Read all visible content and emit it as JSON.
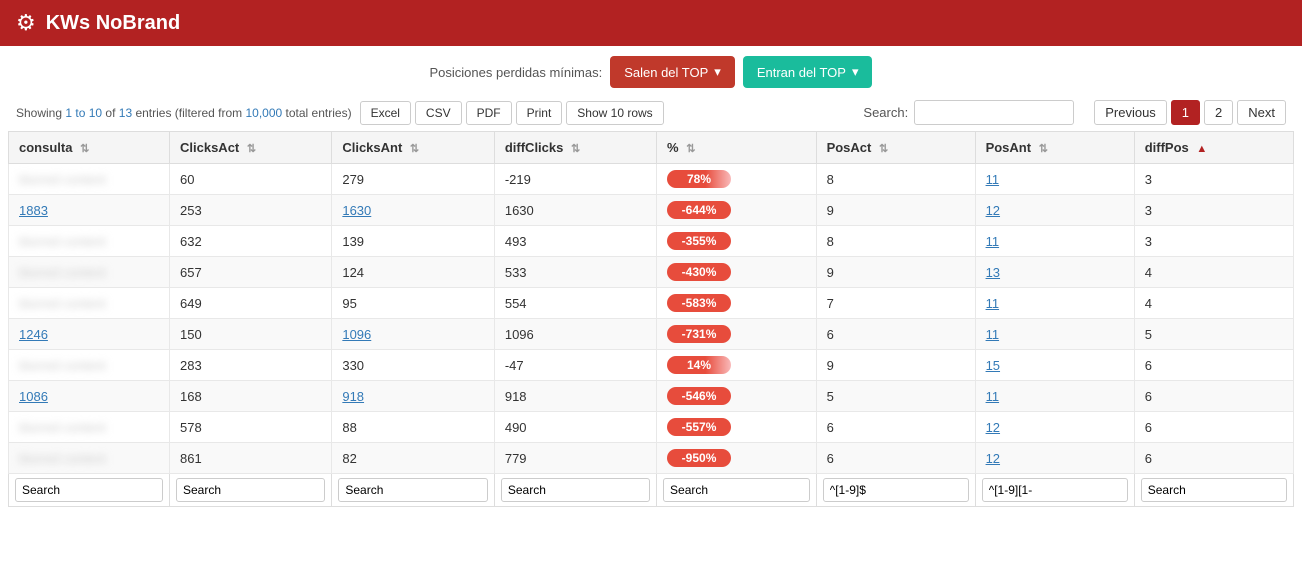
{
  "app": {
    "title": "KWs NoBrand",
    "icon": "⚙"
  },
  "topbar": {
    "label": "Posiciones perdidas mínimas:",
    "btn_salen": "Salen del TOP",
    "btn_entran": "Entran del TOP"
  },
  "subtoolbar": {
    "showing": "Showing ",
    "range": "1 to 10",
    "of": " of ",
    "total": "13",
    "entries": " entries (filtered from ",
    "total_entries": "10,000",
    "total_suffix": " total entries)",
    "excel": "Excel",
    "csv": "CSV",
    "pdf": "PDF",
    "print": "Print",
    "show_rows": "Show 10 rows",
    "search_label": "Search:",
    "prev": "Previous",
    "next": "Next",
    "page1": "1",
    "page2": "2"
  },
  "columns": [
    {
      "key": "consulta",
      "label": "consulta",
      "sort": "both"
    },
    {
      "key": "clicksact",
      "label": "ClicksAct",
      "sort": "both"
    },
    {
      "key": "clicksant",
      "label": "ClicksAnt",
      "sort": "both"
    },
    {
      "key": "diffclicks",
      "label": "diffClicks",
      "sort": "both"
    },
    {
      "key": "pct",
      "label": "%",
      "sort": "both"
    },
    {
      "key": "posact",
      "label": "PosAct",
      "sort": "both"
    },
    {
      "key": "posant",
      "label": "PosAnt",
      "sort": "both"
    },
    {
      "key": "diffpos",
      "label": "diffPos",
      "sort": "asc"
    }
  ],
  "rows": [
    {
      "consulta": "",
      "blurred": true,
      "clicksact": "60",
      "clicksant": "279",
      "diffclicks": "-219",
      "pct": "78%",
      "pct_type": "positive",
      "posact": "8",
      "posant": "11",
      "posant_blue": true,
      "diffpos": "3"
    },
    {
      "consulta": "1883",
      "blurred": false,
      "link": true,
      "clicksact": "253",
      "clicksant": "1630",
      "diffclicks": "1630",
      "pct": "-644%",
      "pct_type": "negative",
      "posact": "9",
      "posant": "12",
      "posant_blue": true,
      "diffpos": "3"
    },
    {
      "consulta": "",
      "blurred": true,
      "clicksact": "632",
      "clicksant": "139",
      "diffclicks": "493",
      "pct": "-355%",
      "pct_type": "negative",
      "posact": "8",
      "posant": "11",
      "posant_blue": true,
      "diffpos": "3"
    },
    {
      "consulta": "",
      "blurred": true,
      "clicksact": "657",
      "clicksant": "124",
      "diffclicks": "533",
      "pct": "-430%",
      "pct_type": "negative",
      "posact": "9",
      "posant": "13",
      "posant_blue": true,
      "diffpos": "4"
    },
    {
      "consulta": "",
      "blurred": true,
      "clicksact": "649",
      "clicksant": "95",
      "diffclicks": "554",
      "pct": "-583%",
      "pct_type": "negative",
      "posact": "7",
      "posant": "11",
      "posant_blue": true,
      "diffpos": "4"
    },
    {
      "consulta": "1246",
      "blurred": false,
      "link": true,
      "clicksact": "150",
      "clicksant": "1096",
      "diffclicks": "1096",
      "pct": "-731%",
      "pct_type": "negative",
      "posact": "6",
      "posant": "11",
      "posant_blue": true,
      "diffpos": "5"
    },
    {
      "consulta": "",
      "blurred": true,
      "clicksact": "283",
      "clicksant": "330",
      "diffclicks": "-47",
      "pct": "14%",
      "pct_type": "positive",
      "posact": "9",
      "posant": "15",
      "posant_blue": true,
      "diffpos": "6"
    },
    {
      "consulta": "1086",
      "blurred": false,
      "link": true,
      "clicksact": "168",
      "clicksant": "918",
      "diffclicks": "918",
      "pct": "-546%",
      "pct_type": "negative",
      "posact": "5",
      "posant": "11",
      "posant_blue": true,
      "diffpos": "6"
    },
    {
      "consulta": "",
      "blurred": true,
      "clicksact": "578",
      "clicksant": "88",
      "diffclicks": "490",
      "pct": "-557%",
      "pct_type": "negative",
      "posact": "6",
      "posant": "12",
      "posant_blue": true,
      "diffpos": "6"
    },
    {
      "consulta": "",
      "blurred": true,
      "clicksact": "861",
      "clicksant": "82",
      "diffclicks": "779",
      "pct": "-950%",
      "pct_type": "negative",
      "posact": "6",
      "posant": "12",
      "posant_blue": true,
      "diffpos": "6"
    }
  ],
  "footer_search": {
    "consulta": "Search",
    "clicksact": "Search",
    "clicksant": "Search",
    "diffclicks": "Search",
    "pct": "Search",
    "posact": "^[1-9]$",
    "posant": "^[1-9][1-",
    "diffpos": "Search"
  }
}
